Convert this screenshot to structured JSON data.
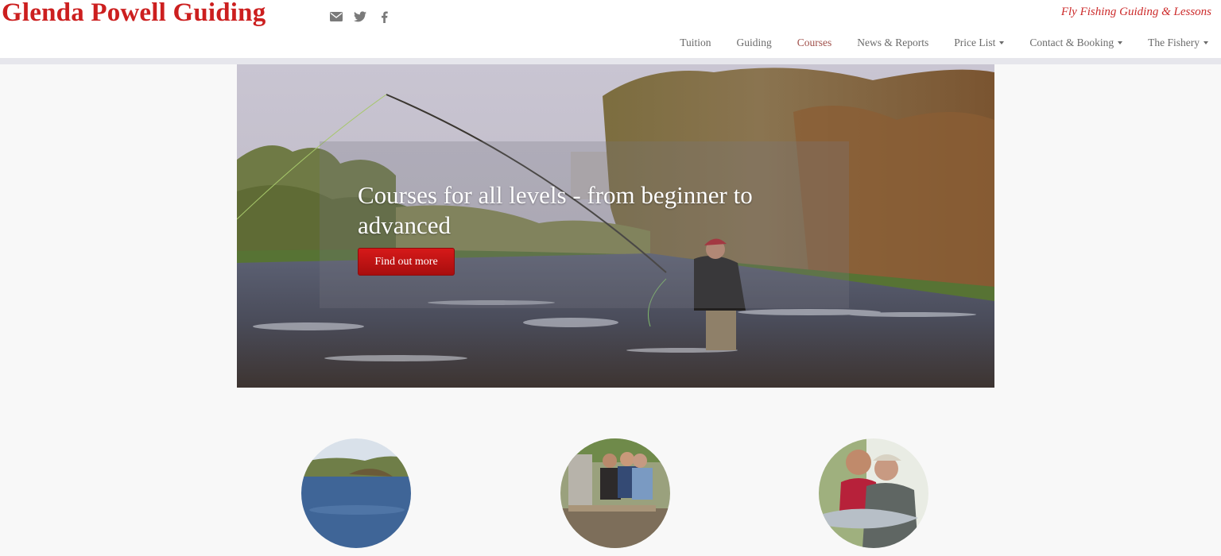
{
  "header": {
    "brand": "Glenda Powell Guiding",
    "tagline": "Fly Fishing Guiding & Lessons",
    "social": [
      {
        "icon": "envelope-icon"
      },
      {
        "icon": "twitter-icon"
      },
      {
        "icon": "facebook-icon"
      }
    ]
  },
  "nav": {
    "items": [
      {
        "label": "Tuition",
        "dropdown": false
      },
      {
        "label": "Guiding",
        "dropdown": false
      },
      {
        "label": "Courses",
        "dropdown": false,
        "active": true
      },
      {
        "label": "News & Reports",
        "dropdown": false
      },
      {
        "label": "Price List",
        "dropdown": true
      },
      {
        "label": "Contact & Booking",
        "dropdown": true
      },
      {
        "label": "The Fishery",
        "dropdown": true
      }
    ]
  },
  "hero": {
    "title": "Courses for all levels - from beginner to advanced",
    "button_label": "Find out more",
    "image": "angler-casting-river-photo"
  },
  "features": [
    {
      "image": "river-landscape-photo"
    },
    {
      "image": "group-at-table-photo"
    },
    {
      "image": "anglers-with-salmon-photo"
    }
  ],
  "colors": {
    "brand": "#cc1f1f",
    "button": "#c41414",
    "nav_active": "#a0504a",
    "nav_text": "#6b6b6b"
  }
}
